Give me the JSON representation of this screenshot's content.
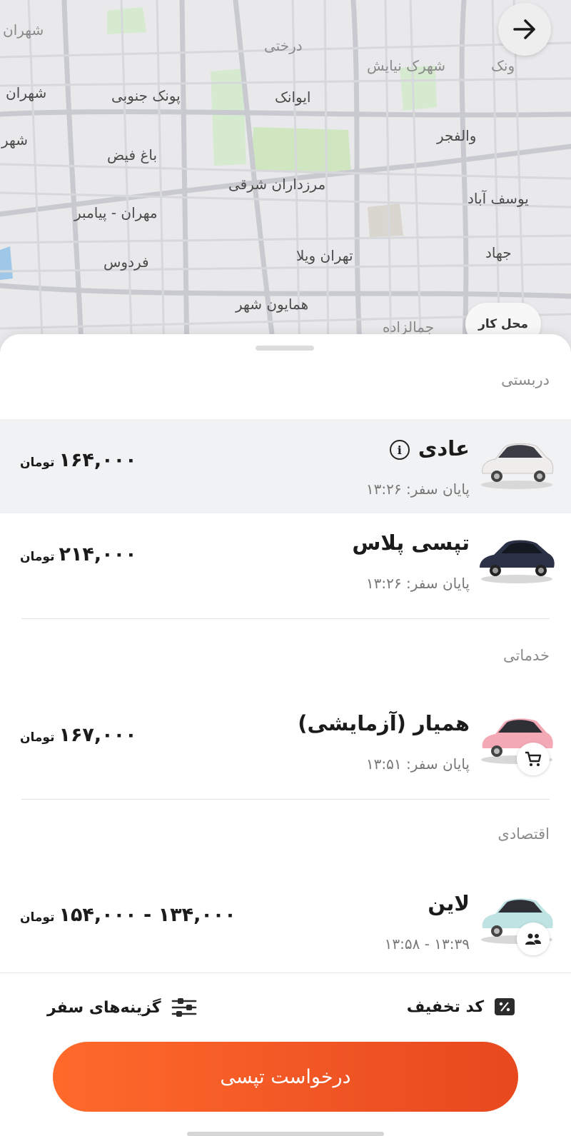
{
  "map": {
    "labels": [
      "شهران",
      "درختی",
      "شهرک نیایش",
      "ونک",
      "شهران",
      "پونک جنوبی",
      "ایوانک",
      "شهر",
      "باغ فیض",
      "والفجر",
      "مرزداران شرقی",
      "یوسف آباد",
      "مهران - پیامبر",
      "تهران ویلا",
      "جهاد",
      "فردوس",
      "همایون شهر",
      "جمالزاده"
    ],
    "place_chip": "محل کار",
    "back_icon": "arrow-right-icon"
  },
  "sections": {
    "private": "دربستی",
    "services": "خدماتی",
    "economy": "اقتصادی"
  },
  "rides": [
    {
      "name": "عادی",
      "sub": "پایان سفر: ۱۳:۲۶",
      "price": "۱۶۴,۰۰۰",
      "unit": "تومان",
      "color": "#f1efef",
      "selected": true
    },
    {
      "name": "تپسی پلاس",
      "sub": "پایان سفر: ۱۳:۲۶",
      "price": "۲۱۴,۰۰۰",
      "unit": "تومان",
      "color": "#2b3146",
      "selected": false
    },
    {
      "name": "همیار (آزمایشی)",
      "sub": "پایان سفر: ۱۳:۵۱",
      "price": "۱۶۷,۰۰۰",
      "unit": "تومان",
      "color": "#f4a9b6",
      "badge": "cart-icon",
      "selected": false
    },
    {
      "name": "لاین",
      "sub": "۱۳:۳۹ - ۱۳:۵۸",
      "price": "۱۳۴,۰۰۰ - ۱۵۴,۰۰۰",
      "unit": "تومان",
      "color": "#bfe3e3",
      "badge": "people-icon",
      "selected": false
    }
  ],
  "bottom": {
    "discount_label": "کد تخفیف",
    "trip_options_label": "گزینه‌های سفر",
    "request_label": "درخواست تپسی"
  },
  "colors": {
    "accent": "#f05524",
    "selected_row": "#f1f2f3"
  }
}
